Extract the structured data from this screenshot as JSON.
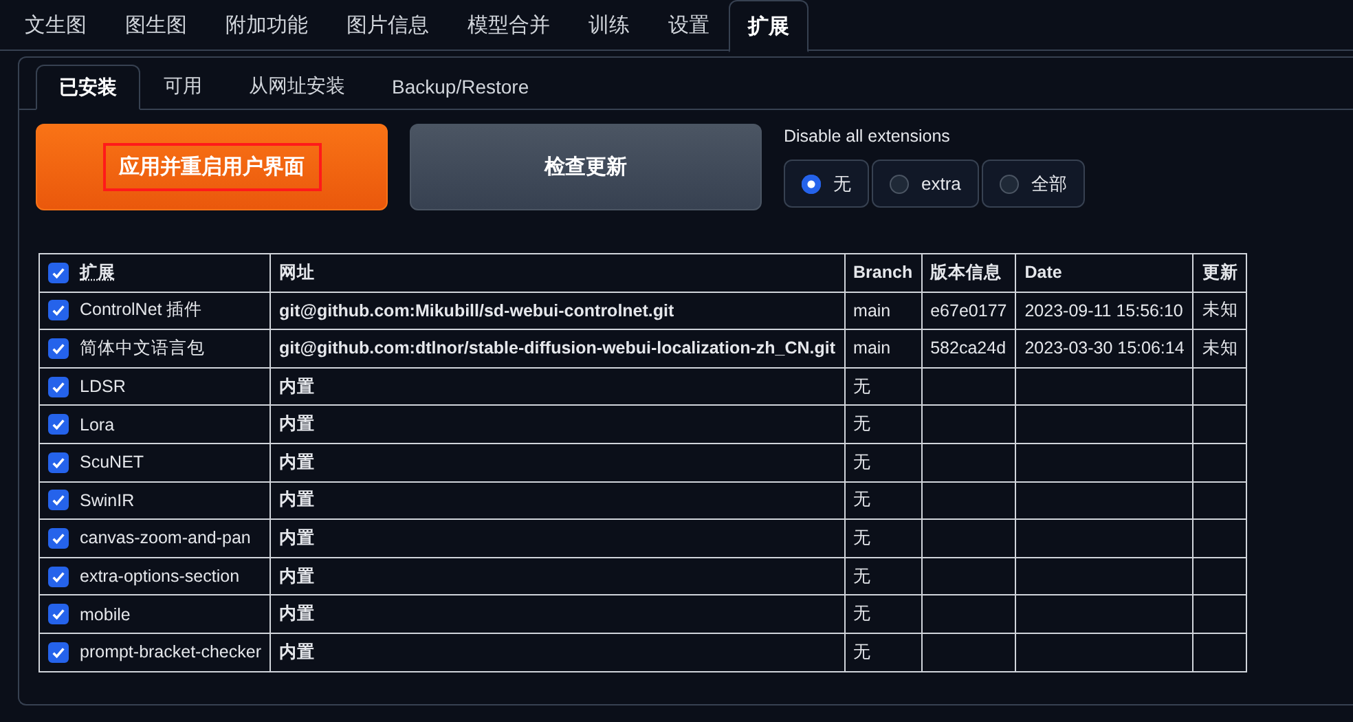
{
  "main_tabs": [
    {
      "label": "文生图",
      "selected": false
    },
    {
      "label": "图生图",
      "selected": false
    },
    {
      "label": "附加功能",
      "selected": false
    },
    {
      "label": "图片信息",
      "selected": false
    },
    {
      "label": "模型合并",
      "selected": false
    },
    {
      "label": "训练",
      "selected": false
    },
    {
      "label": "设置",
      "selected": false
    },
    {
      "label": "扩展",
      "selected": true
    }
  ],
  "sub_tabs": [
    {
      "label": "已安装",
      "selected": true
    },
    {
      "label": "可用",
      "selected": false
    },
    {
      "label": "从网址安装",
      "selected": false
    },
    {
      "label": "Backup/Restore",
      "selected": false
    }
  ],
  "apply_button": {
    "label": "应用并重启用户界面",
    "highlighted": true
  },
  "check_button": {
    "label": "检查更新"
  },
  "disable_all": {
    "label": "Disable all extensions",
    "options": [
      {
        "label": "无",
        "selected": true
      },
      {
        "label": "extra",
        "selected": false
      },
      {
        "label": "全部",
        "selected": false
      }
    ]
  },
  "table": {
    "header_checked": true,
    "columns": [
      "扩展",
      "网址",
      "Branch",
      "版本信息",
      "Date",
      "更新"
    ],
    "rows": [
      {
        "checked": true,
        "name": "ControlNet 插件",
        "url": "git@github.com:Mikubill/sd-webui-controlnet.git",
        "branch": "main",
        "version": "e67e0177",
        "date": "2023-09-11 15:56:10",
        "update": "未知"
      },
      {
        "checked": true,
        "name": "简体中文语言包",
        "url": "git@github.com:dtlnor/stable-diffusion-webui-localization-zh_CN.git",
        "branch": "main",
        "version": "582ca24d",
        "date": "2023-03-30 15:06:14",
        "update": "未知"
      },
      {
        "checked": true,
        "name": "LDSR",
        "url": "内置",
        "branch": "无"
      },
      {
        "checked": true,
        "name": "Lora",
        "url": "内置",
        "branch": "无"
      },
      {
        "checked": true,
        "name": "ScuNET",
        "url": "内置",
        "branch": "无"
      },
      {
        "checked": true,
        "name": "SwinIR",
        "url": "内置",
        "branch": "无"
      },
      {
        "checked": true,
        "name": "canvas-zoom-and-pan",
        "url": "内置",
        "branch": "无"
      },
      {
        "checked": true,
        "name": "extra-options-section",
        "url": "内置",
        "branch": "无"
      },
      {
        "checked": true,
        "name": "mobile",
        "url": "内置",
        "branch": "无"
      },
      {
        "checked": true,
        "name": "prompt-bracket-checker",
        "url": "内置",
        "branch": "无"
      }
    ]
  }
}
